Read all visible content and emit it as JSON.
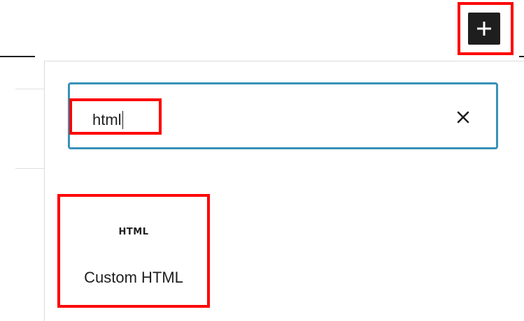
{
  "inserter_toggle": {
    "icon": "plus-icon"
  },
  "search": {
    "value": "html",
    "clear_icon": "close-icon",
    "focus_color": "#3792b9"
  },
  "results": [
    {
      "icon_text": "HTML",
      "label": "Custom HTML"
    }
  ],
  "annotation_color": "#ff0000"
}
